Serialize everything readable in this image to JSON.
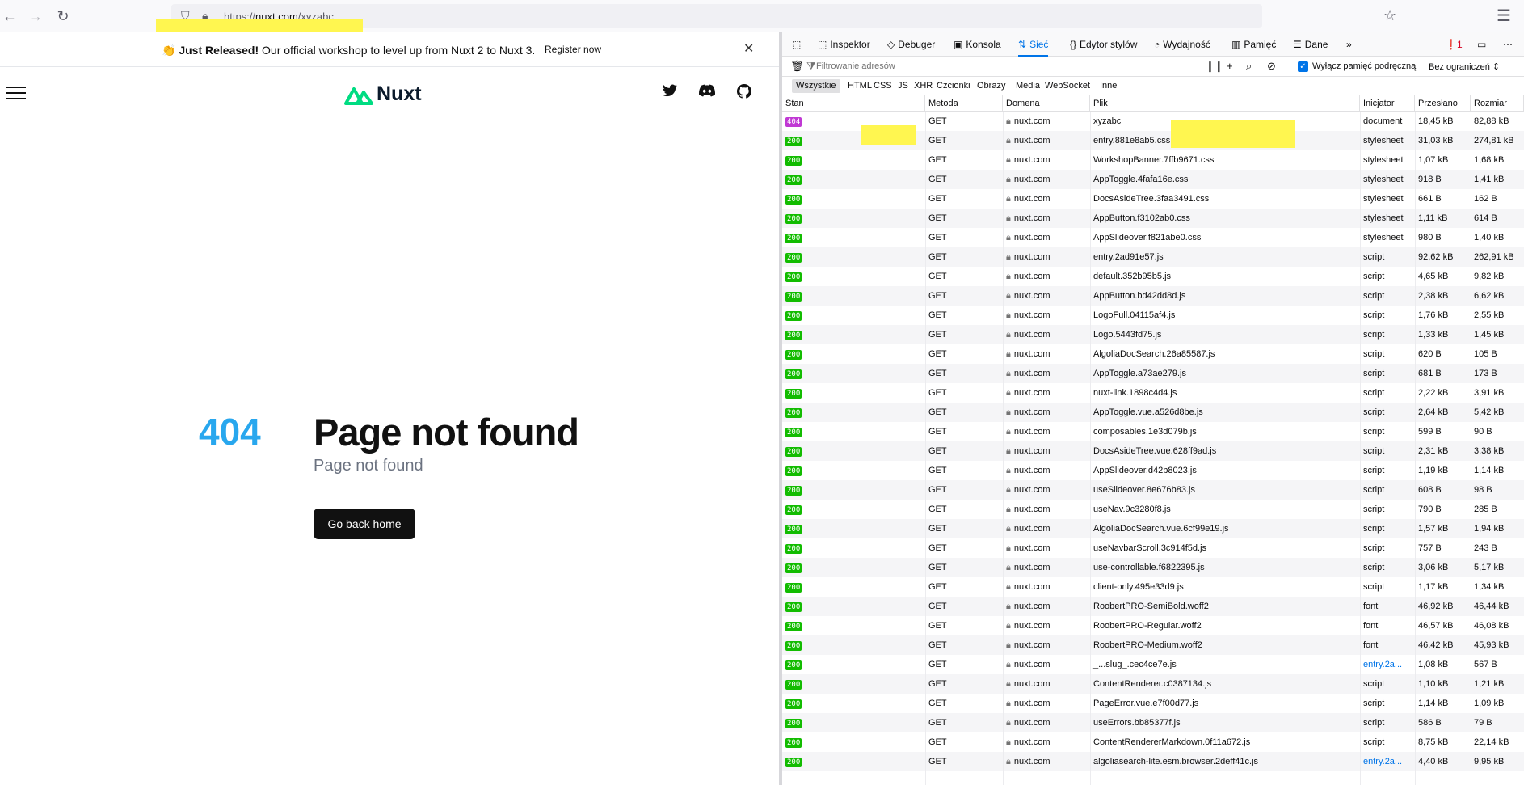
{
  "browser": {
    "url_prefix": "https://",
    "url_domain": "nuxt.com",
    "url_path": "/xyzabc"
  },
  "page": {
    "banner": {
      "emoji": "👏",
      "bold": "Just Released!",
      "text": " Our official workshop to level up from Nuxt 2 to Nuxt 3.",
      "link": "Register now"
    },
    "logo_text": "Nuxt",
    "error": {
      "code": "404",
      "title": "Page not found",
      "subtitle": "Page not found",
      "button": "Go back home"
    }
  },
  "devtools": {
    "tabs": [
      {
        "icon": "⬚",
        "label": "Inspektor"
      },
      {
        "icon": "◇",
        "label": "Debuger"
      },
      {
        "icon": "▣",
        "label": "Konsola"
      },
      {
        "icon": "⇅",
        "label": "Sieć"
      },
      {
        "icon": "{}",
        "label": "Edytor stylów"
      },
      {
        "icon": "◔",
        "label": "Wydajność"
      },
      {
        "icon": "▥",
        "label": "Pamięć"
      },
      {
        "icon": "☰",
        "label": "Dane"
      }
    ],
    "more_tabs": "»",
    "error_count": "1",
    "filter_placeholder": "Filtrowanie adresów",
    "disable_cache": "Wyłącz pamięć podręczną",
    "throttle": "Bez ograniczeń ⇕",
    "types": [
      "Wszystkie",
      "HTML",
      "CSS",
      "JS",
      "XHR",
      "Czcionki",
      "Obrazy",
      "Media",
      "WebSocket",
      "Inne"
    ],
    "columns": [
      "Stan",
      "Metoda",
      "Domena",
      "Plik",
      "Inicjator",
      "Przesłano",
      "Rozmiar"
    ],
    "rows": [
      {
        "status": "404",
        "method": "GET",
        "domain": "nuxt.com",
        "file": "xyzabc",
        "initiator": "document",
        "transferred": "18,45 kB",
        "size": "82,88 kB"
      },
      {
        "status": "200",
        "method": "GET",
        "domain": "nuxt.com",
        "file": "entry.881e8ab5.css",
        "initiator": "stylesheet",
        "transferred": "31,03 kB",
        "size": "274,81 kB"
      },
      {
        "status": "200",
        "method": "GET",
        "domain": "nuxt.com",
        "file": "WorkshopBanner.7ffb9671.css",
        "initiator": "stylesheet",
        "transferred": "1,07 kB",
        "size": "1,68 kB"
      },
      {
        "status": "200",
        "method": "GET",
        "domain": "nuxt.com",
        "file": "AppToggle.4fafa16e.css",
        "initiator": "stylesheet",
        "transferred": "918 B",
        "size": "1,41 kB"
      },
      {
        "status": "200",
        "method": "GET",
        "domain": "nuxt.com",
        "file": "DocsAsideTree.3faa3491.css",
        "initiator": "stylesheet",
        "transferred": "661 B",
        "size": "162 B"
      },
      {
        "status": "200",
        "method": "GET",
        "domain": "nuxt.com",
        "file": "AppButton.f3102ab0.css",
        "initiator": "stylesheet",
        "transferred": "1,11 kB",
        "size": "614 B"
      },
      {
        "status": "200",
        "method": "GET",
        "domain": "nuxt.com",
        "file": "AppSlideover.f821abe0.css",
        "initiator": "stylesheet",
        "transferred": "980 B",
        "size": "1,40 kB"
      },
      {
        "status": "200",
        "method": "GET",
        "domain": "nuxt.com",
        "file": "entry.2ad91e57.js",
        "initiator": "script",
        "transferred": "92,62 kB",
        "size": "262,91 kB"
      },
      {
        "status": "200",
        "method": "GET",
        "domain": "nuxt.com",
        "file": "default.352b95b5.js",
        "initiator": "script",
        "transferred": "4,65 kB",
        "size": "9,82 kB"
      },
      {
        "status": "200",
        "method": "GET",
        "domain": "nuxt.com",
        "file": "AppButton.bd42dd8d.js",
        "initiator": "script",
        "transferred": "2,38 kB",
        "size": "6,62 kB"
      },
      {
        "status": "200",
        "method": "GET",
        "domain": "nuxt.com",
        "file": "LogoFull.04115af4.js",
        "initiator": "script",
        "transferred": "1,76 kB",
        "size": "2,55 kB"
      },
      {
        "status": "200",
        "method": "GET",
        "domain": "nuxt.com",
        "file": "Logo.5443fd75.js",
        "initiator": "script",
        "transferred": "1,33 kB",
        "size": "1,45 kB"
      },
      {
        "status": "200",
        "method": "GET",
        "domain": "nuxt.com",
        "file": "AlgoliaDocSearch.26a85587.js",
        "initiator": "script",
        "transferred": "620 B",
        "size": "105 B"
      },
      {
        "status": "200",
        "method": "GET",
        "domain": "nuxt.com",
        "file": "AppToggle.a73ae279.js",
        "initiator": "script",
        "transferred": "681 B",
        "size": "173 B"
      },
      {
        "status": "200",
        "method": "GET",
        "domain": "nuxt.com",
        "file": "nuxt-link.1898c4d4.js",
        "initiator": "script",
        "transferred": "2,22 kB",
        "size": "3,91 kB"
      },
      {
        "status": "200",
        "method": "GET",
        "domain": "nuxt.com",
        "file": "AppToggle.vue.a526d8be.js",
        "initiator": "script",
        "transferred": "2,64 kB",
        "size": "5,42 kB"
      },
      {
        "status": "200",
        "method": "GET",
        "domain": "nuxt.com",
        "file": "composables.1e3d079b.js",
        "initiator": "script",
        "transferred": "599 B",
        "size": "90 B"
      },
      {
        "status": "200",
        "method": "GET",
        "domain": "nuxt.com",
        "file": "DocsAsideTree.vue.628ff9ad.js",
        "initiator": "script",
        "transferred": "2,31 kB",
        "size": "3,38 kB"
      },
      {
        "status": "200",
        "method": "GET",
        "domain": "nuxt.com",
        "file": "AppSlideover.d42b8023.js",
        "initiator": "script",
        "transferred": "1,19 kB",
        "size": "1,14 kB"
      },
      {
        "status": "200",
        "method": "GET",
        "domain": "nuxt.com",
        "file": "useSlideover.8e676b83.js",
        "initiator": "script",
        "transferred": "608 B",
        "size": "98 B"
      },
      {
        "status": "200",
        "method": "GET",
        "domain": "nuxt.com",
        "file": "useNav.9c3280f8.js",
        "initiator": "script",
        "transferred": "790 B",
        "size": "285 B"
      },
      {
        "status": "200",
        "method": "GET",
        "domain": "nuxt.com",
        "file": "AlgoliaDocSearch.vue.6cf99e19.js",
        "initiator": "script",
        "transferred": "1,57 kB",
        "size": "1,94 kB"
      },
      {
        "status": "200",
        "method": "GET",
        "domain": "nuxt.com",
        "file": "useNavbarScroll.3c914f5d.js",
        "initiator": "script",
        "transferred": "757 B",
        "size": "243 B"
      },
      {
        "status": "200",
        "method": "GET",
        "domain": "nuxt.com",
        "file": "use-controllable.f6822395.js",
        "initiator": "script",
        "transferred": "3,06 kB",
        "size": "5,17 kB"
      },
      {
        "status": "200",
        "method": "GET",
        "domain": "nuxt.com",
        "file": "client-only.495e33d9.js",
        "initiator": "script",
        "transferred": "1,17 kB",
        "size": "1,34 kB"
      },
      {
        "status": "200",
        "method": "GET",
        "domain": "nuxt.com",
        "file": "RoobertPRO-SemiBold.woff2",
        "initiator": "font",
        "transferred": "46,92 kB",
        "size": "46,44 kB"
      },
      {
        "status": "200",
        "method": "GET",
        "domain": "nuxt.com",
        "file": "RoobertPRO-Regular.woff2",
        "initiator": "font",
        "transferred": "46,57 kB",
        "size": "46,08 kB"
      },
      {
        "status": "200",
        "method": "GET",
        "domain": "nuxt.com",
        "file": "RoobertPRO-Medium.woff2",
        "initiator": "font",
        "transferred": "46,42 kB",
        "size": "45,93 kB"
      },
      {
        "status": "200",
        "method": "GET",
        "domain": "nuxt.com",
        "file": "_...slug_.cec4ce7e.js",
        "initiator": "entry.2a...",
        "transferred": "1,08 kB",
        "size": "567 B",
        "link": true
      },
      {
        "status": "200",
        "method": "GET",
        "domain": "nuxt.com",
        "file": "ContentRenderer.c0387134.js",
        "initiator": "script",
        "transferred": "1,10 kB",
        "size": "1,21 kB"
      },
      {
        "status": "200",
        "method": "GET",
        "domain": "nuxt.com",
        "file": "PageError.vue.e7f00d77.js",
        "initiator": "script",
        "transferred": "1,14 kB",
        "size": "1,09 kB"
      },
      {
        "status": "200",
        "method": "GET",
        "domain": "nuxt.com",
        "file": "useErrors.bb85377f.js",
        "initiator": "script",
        "transferred": "586 B",
        "size": "79 B"
      },
      {
        "status": "200",
        "method": "GET",
        "domain": "nuxt.com",
        "file": "ContentRendererMarkdown.0f11a672.js",
        "initiator": "script",
        "transferred": "8,75 kB",
        "size": "22,14 kB"
      },
      {
        "status": "200",
        "method": "GET",
        "domain": "nuxt.com",
        "file": "algoliasearch-lite.esm.browser.2deff41c.js",
        "initiator": "entry.2a...",
        "transferred": "4,40 kB",
        "size": "9,95 kB",
        "link": true
      }
    ]
  }
}
